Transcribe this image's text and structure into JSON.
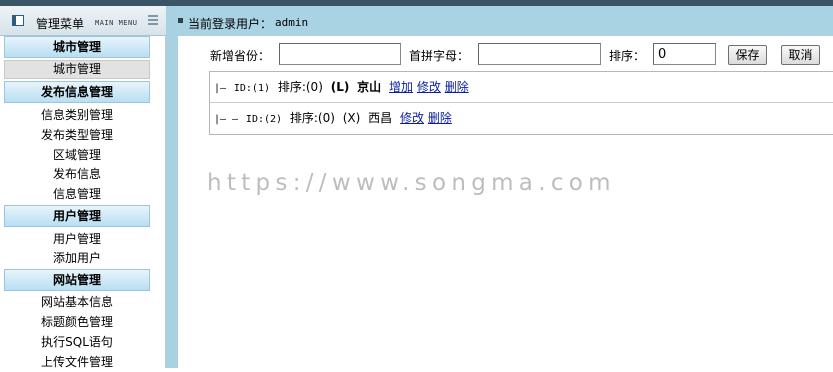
{
  "header": {
    "menu_title": "管理菜单",
    "menu_subtitle": "MAIN MENU",
    "user_label": "当前登录用户：",
    "user_name": "admin"
  },
  "sidebar": {
    "sections": [
      {
        "title": "城市管理",
        "items": [
          "城市管理"
        ]
      },
      {
        "title": "发布信息管理",
        "items": [
          "信息类别管理",
          "发布类型管理",
          "区域管理",
          "发布信息",
          "信息管理"
        ]
      },
      {
        "title": "用户管理",
        "items": [
          "用户管理",
          "添加用户"
        ]
      },
      {
        "title": "网站管理",
        "items": [
          "网站基本信息",
          "标题颜色管理",
          "执行SQL语句",
          "上传文件管理"
        ]
      }
    ],
    "selected_item": "城市管理"
  },
  "form": {
    "province_label": "新增省份：",
    "province_value": "",
    "initial_label": "首拼字母：",
    "initial_value": "",
    "order_label": "排序：",
    "order_value": "0",
    "save_label": "保存",
    "cancel_label": "取消"
  },
  "tree": {
    "rows": [
      {
        "prefix": "|—",
        "id_text": "ID:(1)",
        "order_text": "排序:(0)",
        "letter": "(L)",
        "name": "京山",
        "add": "增加",
        "edit": "修改",
        "delete": "删除"
      },
      {
        "prefix": "|— —",
        "id_text": "ID:(2)",
        "order_text": "排序:(0)",
        "letter": "(X)",
        "name": "西昌",
        "edit": "修改",
        "delete": "删除"
      }
    ]
  },
  "watermark": "https://www.songma.com"
}
